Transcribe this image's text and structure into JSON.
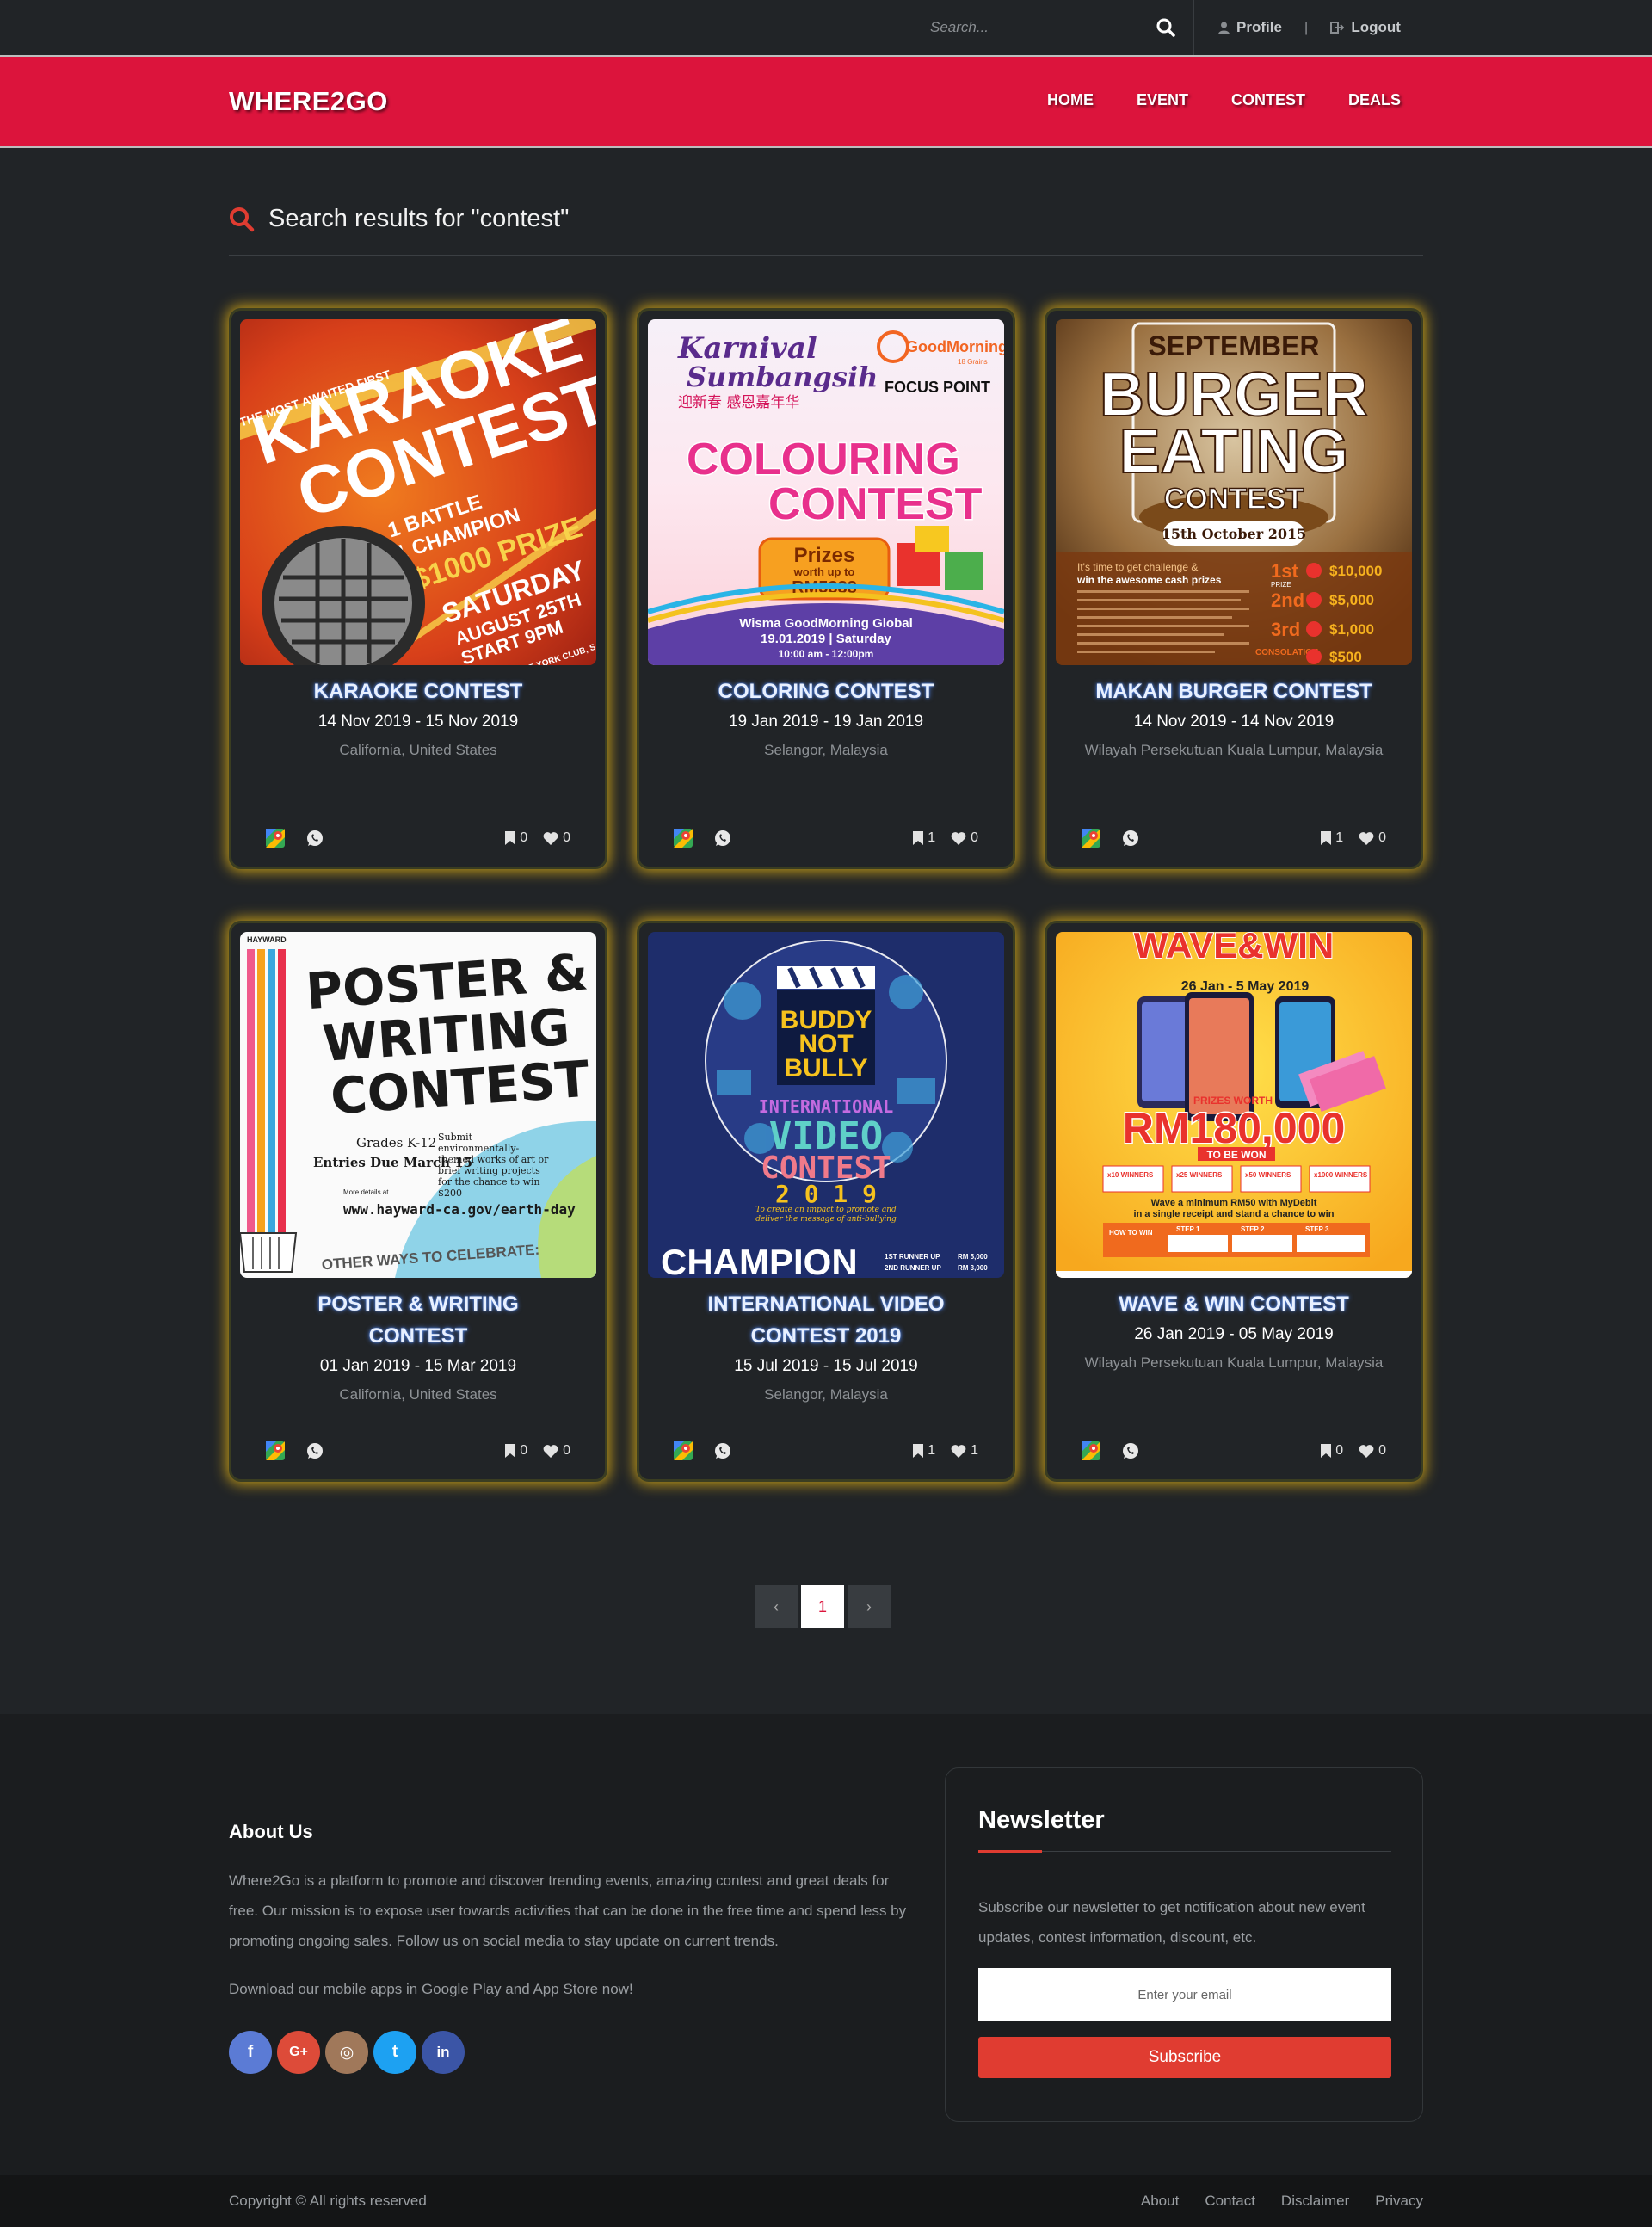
{
  "topbar": {
    "search_placeholder": "Search...",
    "search_icon": "search-icon",
    "profile_label": "Profile",
    "separator": "|",
    "logout_label": "Logout"
  },
  "navbar": {
    "brand": "WHERE2GO",
    "items": [
      {
        "label": "HOME"
      },
      {
        "label": "EVENT"
      },
      {
        "label": "CONTEST"
      },
      {
        "label": "DEALS"
      }
    ]
  },
  "results": {
    "title": "Search results for \"contest\"",
    "icon": "search-icon"
  },
  "cards": [
    {
      "title": "KARAOKE CONTEST",
      "date": "14 Nov 2019 - 15 Nov 2019",
      "location": "California, United States",
      "bookmarks": "0",
      "likes": "0",
      "poster": {
        "line1": "THE MOST AWAITED FIRST",
        "line2": "KARAOKE",
        "line3": "CONTEST",
        "line4": "1 BATTLE",
        "line5": "1 CHAMPION",
        "line6": "$1000 PRIZE",
        "line7": "SATURDAY",
        "line8": "AUGUST 25TH",
        "line9": "START 9PM",
        "line10": "EAST SIDE YORK CLUB, SAN FRANCISCO, CA"
      }
    },
    {
      "title": "COLORING CONTEST",
      "date": "19 Jan 2019 - 19 Jan 2019",
      "location": "Selangor, Malaysia",
      "bookmarks": "1",
      "likes": "0",
      "poster": {
        "line1": "Karnival",
        "line2": "Sumbangsih",
        "line3": "迎新春 感恩嘉年华",
        "line4": "GoodMorning",
        "line5": "18 Grains",
        "line6": "FOCUS POINT",
        "line7": "COLOURING",
        "line8": "CONTEST",
        "line9": "Prizes",
        "line10": "worth up to",
        "line11": "RM5888",
        "line12": "Wisma GoodMorning Global",
        "line13": "19.01.2019 | Saturday",
        "line14": "10:00 am - 12:00pm"
      }
    },
    {
      "title": "MAKAN BURGER CONTEST",
      "date": "14 Nov 2019 - 14 Nov 2019",
      "location": "Wilayah Persekutuan Kuala Lumpur, Malaysia",
      "bookmarks": "1",
      "likes": "0",
      "poster": {
        "line1": "SEPTEMBER",
        "line2": "BURGER",
        "line3": "EATING",
        "line4": "CONTEST",
        "line5": "15th October 2015",
        "line6": "It's time to get challenge &",
        "line7": "win the awesome cash prizes",
        "line8": "1st",
        "line9": "$10,000",
        "line10": "2nd",
        "line11": "$5,000",
        "line12": "3rd",
        "line13": "$1,000",
        "line14": "CONSOLATION",
        "line15": "$500",
        "line16": "PRIZE"
      }
    },
    {
      "title": "POSTER & WRITING CONTEST",
      "date": "01 Jan 2019 - 15 Mar 2019",
      "location": "California, United States",
      "bookmarks": "0",
      "likes": "0",
      "poster": {
        "line1": "HAYWARD",
        "line2": "POSTER &",
        "line3": "WRITING",
        "line4": "CONTEST",
        "line5": "Grades K-12",
        "line6": "Entries Due March 15",
        "line7": "Submit environmentally-themed works of art or brief writing projects for the chance to win $200",
        "line8": "More details at",
        "line9": "www.hayward-ca.gov/earth-day",
        "line10": "OTHER WAYS TO CELEBRATE:"
      }
    },
    {
      "title": "INTERNATIONAL VIDEO CONTEST 2019",
      "date": "15 Jul 2019 - 15 Jul 2019",
      "location": "Selangor, Malaysia",
      "bookmarks": "1",
      "likes": "1",
      "poster": {
        "line1": "BUDDY",
        "line2": "NOT",
        "line3": "BULLY",
        "line4": "INTERNATIONAL",
        "line5": "VIDEO",
        "line6": "CONTEST",
        "line7": "2 0 1 9",
        "line8": "To create an impact to promote and deliver the message of anti-bullying",
        "line9": "CHAMPION",
        "line10": "1ST RUNNER UP",
        "line11": "2ND RUNNER UP",
        "line12": "RM 5,000",
        "line13": "RM 3,000"
      }
    },
    {
      "title": "WAVE & WIN CONTEST",
      "date": "26 Jan 2019 - 05 May 2019",
      "location": "Wilayah Persekutuan Kuala Lumpur, Malaysia",
      "bookmarks": "0",
      "likes": "0",
      "poster": {
        "line1": "WAVE&WIN",
        "line2": "26 Jan - 5 May 2019",
        "line3": "PRIZES WORTH",
        "line4": "RM180,000",
        "line5": "TO BE WON",
        "line6": "x10 WINNERS",
        "line7": "x25 WINNERS",
        "line8": "x50 WINNERS",
        "line9": "x1000 WINNERS",
        "line10": "Wave a minimum RM50 with MyDebit",
        "line11": "in a single receipt and stand a chance to win",
        "line12": "HOW TO WIN",
        "line13": "STEP 1",
        "line14": "STEP 2",
        "line15": "STEP 3"
      }
    }
  ],
  "card_icons": {
    "map": "google-maps-icon",
    "chat": "whatsapp-icon",
    "bookmark": "bookmark-icon",
    "like": "heart-icon"
  },
  "pagination": {
    "prev": "‹",
    "current": "1",
    "next": "›"
  },
  "footer": {
    "about_title": "About Us",
    "about_text": "Where2Go is a platform to promote and discover trending events, amazing contest and great deals for free. Our mission is to expose user towards activities that can be done in the free time and spend less by promoting ongoing sales. Follow us on social media to stay update on current trends.",
    "download_text": "Download our mobile apps in Google Play and App Store now!",
    "socials": [
      {
        "icon": "facebook-icon",
        "glyph": "f",
        "color": "#5b7bd5"
      },
      {
        "icon": "google-plus-icon",
        "glyph": "G+",
        "color": "#dd4b39"
      },
      {
        "icon": "instagram-icon",
        "glyph": "◎",
        "color": "#a0785a"
      },
      {
        "icon": "twitter-icon",
        "glyph": "t",
        "color": "#1da1f2"
      },
      {
        "icon": "linkedin-icon",
        "glyph": "in",
        "color": "#3b55a6"
      }
    ],
    "newsletter": {
      "title": "Newsletter",
      "text": "Subscribe our newsletter to get notification about new event updates, contest information, discount, etc.",
      "placeholder": "Enter your email",
      "button": "Subscribe"
    }
  },
  "bottombar": {
    "copyright": "Copyright © All rights reserved",
    "links": [
      "About",
      "Contact",
      "Disclaimer",
      "Privacy"
    ]
  },
  "colors": {
    "brand_red": "#dc143c",
    "glow_gold": "#e6b414",
    "accent_red": "#e03c31"
  }
}
